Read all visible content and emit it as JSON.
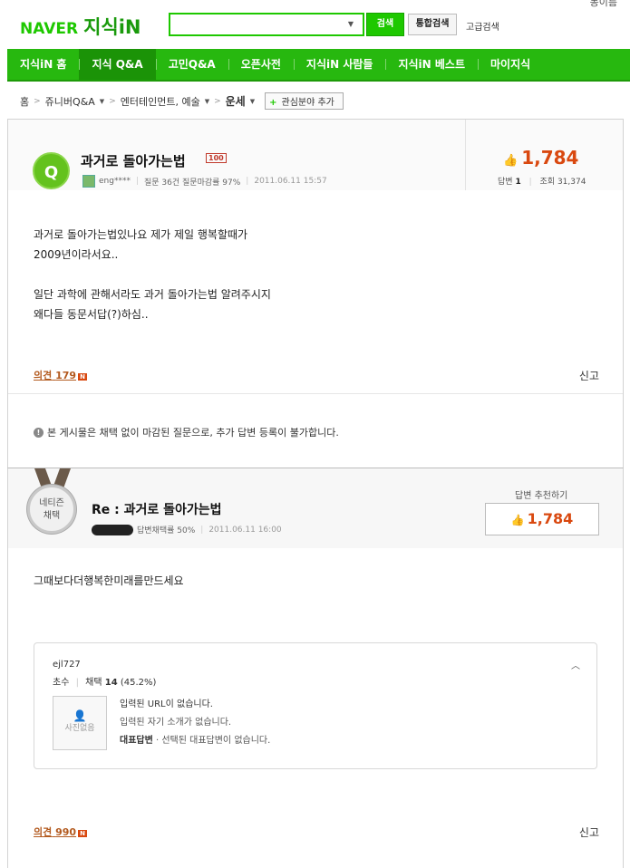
{
  "header": {
    "top_corner": "동이름",
    "logo_naver": "NAVER",
    "logo_service": "지식iN",
    "search": {
      "value": "",
      "placeholder": ""
    },
    "search_button": "검색",
    "total_search_button": "통합검색",
    "advanced_search": "고급검색"
  },
  "nav": {
    "items": [
      "지식iN 홈",
      "지식 Q&A",
      "고민Q&A",
      "오픈사전",
      "지식iN 사람들",
      "지식iN 베스트",
      "마이지식"
    ],
    "active_index": 1
  },
  "breadcrumb": {
    "home": "홈",
    "level1": "쥬니버Q&A",
    "level2": "엔터테인먼트, 예술",
    "current": "운세",
    "add_interest": "관심분야 추가"
  },
  "question": {
    "badge": "Q",
    "title": "과거로 돌아가는법",
    "grade": "100",
    "author": "eng****",
    "stats_summary": "질문 36건 질문마감률 97%",
    "date": "2011.06.11 15:57",
    "score": "1,784",
    "answer_label": "답변",
    "answer_count": "1",
    "view_label": "조회",
    "view_count": "31,374",
    "body_lines": [
      "과거로 돌아가는법있나요 제가 제일 행복할때가",
      "2009년이라서요..",
      "",
      "일단 과학에 관해서라도 과거 돌아가는법 알려주시지",
      "왜다들 동문서답(?)하심.."
    ],
    "opinion_label": "의견",
    "opinion_count": "179",
    "report": "신고",
    "notice": "본 게시물은 채택 없이 마감된 질문으로, 추가 답변 등록이 불가합니다."
  },
  "answer": {
    "medal_line1": "네티즌",
    "medal_line2": "채택",
    "title": "Re : 과거로 돌아가는법",
    "select_rate": "답변채택률 50%",
    "date": "2011.06.11 16:00",
    "recommend_label": "답변 추천하기",
    "score": "1,784",
    "body": "그때보다더행복한미래를만드세요",
    "profile": {
      "id": "ejl727",
      "rank": "초수",
      "adopt_label": "채택",
      "adopt_count": "14",
      "adopt_rate": "(45.2%)",
      "photo_text": "사진없음",
      "no_url": "입력된 URL이 없습니다.",
      "no_intro": "입력된 자기 소개가 없습니다.",
      "rep_label": "대표답변",
      "rep_value": "· 선택된 대표답변이 없습니다."
    },
    "opinion_label": "의견",
    "opinion_count": "990",
    "report": "신고"
  },
  "colors": {
    "brand_green": "#1ec800",
    "nav_green": "#27b80f",
    "score_orange": "#d9480f"
  }
}
